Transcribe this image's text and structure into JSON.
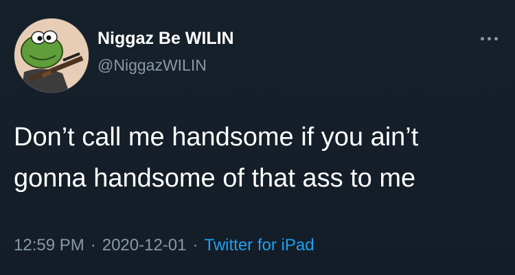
{
  "tweet": {
    "author": {
      "display_name": "Niggaz Be WILIN",
      "handle": "@NiggazWILIN"
    },
    "text_lines": [
      "Don’t call me handsome if you ain’t",
      "gonna handsome of that ass to me"
    ],
    "time": "12:59 PM",
    "separator": "·",
    "date": "2020-12-01",
    "source": "Twitter for iPad"
  },
  "icons": {
    "more": "more-options-icon",
    "avatar": "frog-avatar-icon"
  },
  "colors": {
    "background": "#15202b",
    "text": "#ffffff",
    "secondary": "#8899a6",
    "link": "#1da1f2"
  }
}
